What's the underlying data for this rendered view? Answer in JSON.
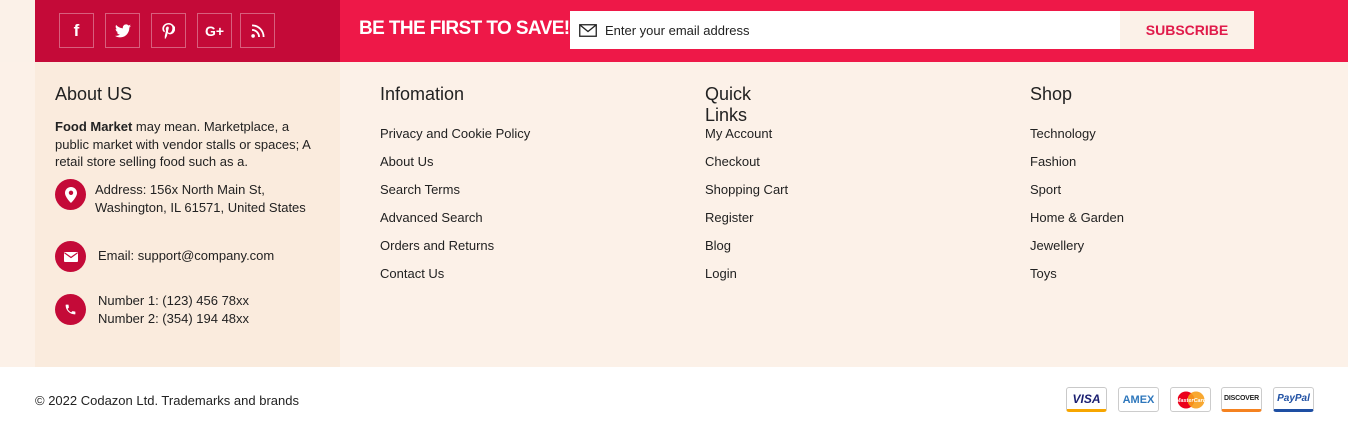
{
  "social": {
    "facebook": "f",
    "googleplus": "G+"
  },
  "newsletter": {
    "promo_text": "BE THE FIRST TO SAVE!",
    "email_placeholder": "Enter your email address",
    "subscribe_label": "SUBSCRIBE"
  },
  "about": {
    "title": "About US",
    "brand": "Food Market",
    "description": " may mean. Marketplace, a public market with vendor stalls or spaces; A retail store selling food such as a.",
    "address_line1": "Address: 156x North Main St,",
    "address_line2": "Washington, IL 61571, United States",
    "email": "Email: support@company.com",
    "phone1": "Number 1: (123) 456 78xx",
    "phone2": "Number 2: (354) 194 48xx"
  },
  "information": {
    "title": "Infomation",
    "links": [
      "Privacy and Cookie Policy",
      "About Us",
      "Search Terms",
      "Advanced Search",
      "Orders and Returns",
      "Contact Us"
    ]
  },
  "quick_links": {
    "title": "Quick Links",
    "links": [
      "My Account",
      "Checkout",
      "Shopping Cart",
      "Register",
      "Blog",
      "Login"
    ]
  },
  "shop": {
    "title": "Shop",
    "links": [
      "Technology",
      "Fashion",
      "Sport",
      "Home & Garden",
      "Jewellery",
      "Toys"
    ]
  },
  "footer": {
    "copyright": "© 2022 Codazon Ltd. Trademarks and brands"
  },
  "payments": {
    "visa": "VISA",
    "amex": "AMEX",
    "mastercard": "MasterCard",
    "discover": "DISCOVER",
    "paypal": "PayPal"
  },
  "colors": {
    "accent": "#ee1848",
    "accent_dark": "#c40a38",
    "footer_bg": "#fcf1e8",
    "about_bg": "#faebdd"
  }
}
